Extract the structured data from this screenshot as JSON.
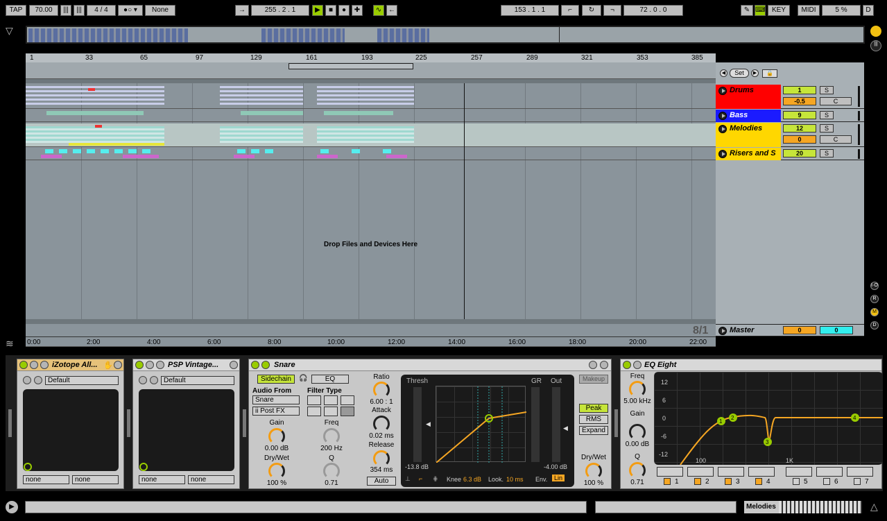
{
  "transport": {
    "tap": "TAP",
    "tempo": "70.00",
    "signature": "4 / 4",
    "quant": "None",
    "position": "255 .  2 .  1",
    "loop_start": "153 .  1 .  1",
    "loop_len": "72 .  0 .  0",
    "key": "KEY",
    "midi": "MIDI",
    "cpu": "5 %",
    "disk": "D"
  },
  "ruler": {
    "bars": [
      "1",
      "33",
      "65",
      "97",
      "129",
      "161",
      "193",
      "225",
      "257",
      "289",
      "321",
      "353",
      "385"
    ],
    "times": [
      "0:00",
      "2:00",
      "4:00",
      "6:00",
      "8:00",
      "10:00",
      "12:00",
      "14:00",
      "16:00",
      "18:00",
      "20:00",
      "22:00"
    ],
    "set": "Set"
  },
  "arrangement": {
    "drop": "Drop Files and Devices Here",
    "timesig": "8/1"
  },
  "tracks": [
    {
      "name": "Drums",
      "color": "#ff0000",
      "num": "1",
      "pan": "-0.5",
      "solo": "S",
      "c": "C"
    },
    {
      "name": "Bass",
      "color": "#1b1bff",
      "num": "9",
      "solo": "S"
    },
    {
      "name": "Melodies",
      "color": "#ffd700",
      "num": "12",
      "pan": "0",
      "solo": "S",
      "c": "C"
    },
    {
      "name": "Risers and S",
      "color": "#ffd700",
      "num": "20",
      "solo": "S"
    }
  ],
  "master": {
    "name": "Master",
    "vol": "0",
    "pan": "0"
  },
  "devices": {
    "izotope": {
      "title": "iZotope All...",
      "preset": "Default",
      "left": "none",
      "right": "none"
    },
    "psp": {
      "title": "PSP Vintage...",
      "preset": "Default",
      "left": "none",
      "right": "none"
    },
    "snare": {
      "title": "Snare",
      "sidechain": "Sidechain",
      "eq": "EQ",
      "audio_from": "Audio From",
      "src": "Snare",
      "post": "ii Post FX",
      "filter_type": "Filter Type",
      "gain": "Gain",
      "gain_val": "0.00 dB",
      "freq": "Freq",
      "freq_val": "200 Hz",
      "drywet": "Dry/Wet",
      "drywet_val": "100 %",
      "q": "Q",
      "q_val": "0.71",
      "ratio": "Ratio",
      "ratio_val": "6.00 : 1",
      "attack": "Attack",
      "attack_val": "0.02 ms",
      "release": "Release",
      "release_val": "354 ms",
      "auto": "Auto",
      "thresh": "Thresh",
      "gr": "GR",
      "out": "Out",
      "thresh_val": "-13.8 dB",
      "out_val": "-4.00 dB",
      "makeup": "Makeup",
      "peak": "Peak",
      "rms": "RMS",
      "expand": "Expand",
      "dw2": "Dry/Wet",
      "dw2_val": "100 %",
      "knee_lbl": "Knee",
      "knee": "6.3 dB",
      "look_lbl": "Look.",
      "look": "10 ms",
      "env_lbl": "Env.",
      "env": "Lin"
    },
    "eq8": {
      "title": "EQ Eight",
      "freq": "Freq",
      "freq_val": "5.00 kHz",
      "gain": "Gain",
      "gain_val": "0.00 dB",
      "q": "Q",
      "q_val": "0.71",
      "db": [
        "12",
        "6",
        "0",
        "-6",
        "-12"
      ],
      "hz": [
        "100",
        "1K"
      ],
      "bands": [
        "1",
        "2",
        "3",
        "4",
        "5",
        "6",
        "7"
      ],
      "points": [
        "1",
        "2",
        "3",
        "4"
      ]
    }
  },
  "status": {
    "track": "Melodies"
  }
}
